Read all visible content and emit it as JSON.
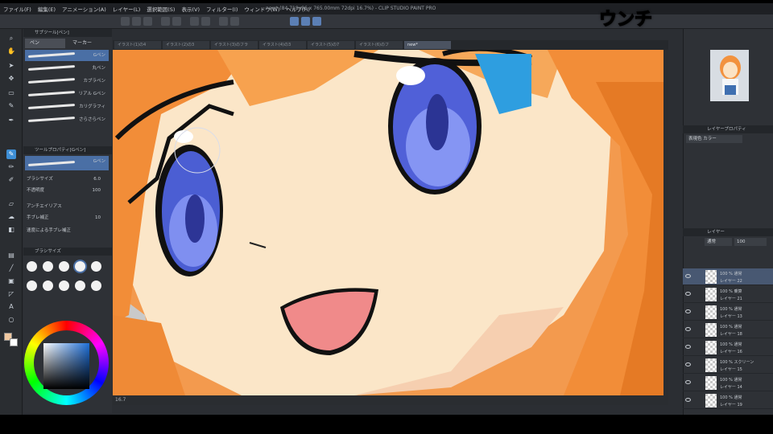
{
  "overlay": {
    "caption": "ウンチ"
  },
  "app": {
    "title": "new* (84 718x96 x 765.00mm 72dpi 16.7%) - CLIP STUDIO PAINT PRO",
    "menu": [
      "ファイル(F)",
      "編集(E)",
      "アニメーション(A)",
      "レイヤー(L)",
      "選択範囲(S)",
      "表示(V)",
      "フィルター(I)",
      "ウィンドウ(W)",
      "ヘルプ(H)"
    ]
  },
  "subtool": {
    "title": "サブツール[ペン]",
    "tabs": [
      "ペン",
      "マーカー"
    ],
    "brushes": [
      "Gペン",
      "丸ペン",
      "カブラペン",
      "リアル Gペン",
      "カリグラフィ",
      "さらさらペン"
    ],
    "selected_brush": 0,
    "detail_title": "ツールプロパティ[Gペン]",
    "detail_brush": "Gペン",
    "props": [
      {
        "label": "ブラシサイズ",
        "value": "6.0"
      },
      {
        "label": "不透明度",
        "value": "100"
      },
      {
        "label": "アンチエイリアス",
        "value": ""
      },
      {
        "label": "手ブレ補正",
        "value": "10"
      },
      {
        "label": "速度による手ブレ補正",
        "value": ""
      }
    ],
    "brush_size_title": "ブラシサイズ"
  },
  "canvas": {
    "tabs": [
      "イラスト(1)の4",
      "イラスト(2)の3",
      "イラスト(3)のフラ",
      "イラスト(4)の3",
      "イラスト(5)の7",
      "イラスト(6)のフ",
      "new*"
    ],
    "active_tab": 6,
    "zoom": "16.7"
  },
  "right": {
    "layer_prop_title": "レイヤープロパティ",
    "expression": "表現色 カラー",
    "layer_panel_title": "レイヤー",
    "blend": "通常",
    "opacity": "100",
    "layers": [
      {
        "mode": "100 % 通常",
        "name": "レイヤー 22",
        "selected": true
      },
      {
        "mode": "100 % 乗算",
        "name": "レイヤー 21",
        "selected": false
      },
      {
        "mode": "100 % 通常",
        "name": "レイヤー 13",
        "selected": false
      },
      {
        "mode": "100 % 通常",
        "name": "レイヤー 18",
        "selected": false
      },
      {
        "mode": "100 % 通常",
        "name": "レイヤー 16",
        "selected": false
      },
      {
        "mode": "100 % スクリーン",
        "name": "レイヤー 15",
        "selected": false
      },
      {
        "mode": "100 % 通常",
        "name": "レイヤー 14",
        "selected": false
      },
      {
        "mode": "100 % 通常",
        "name": "レイヤー 19",
        "selected": false
      }
    ]
  },
  "colors": {
    "main": "#2b78d2",
    "sub": "#ffffff"
  }
}
